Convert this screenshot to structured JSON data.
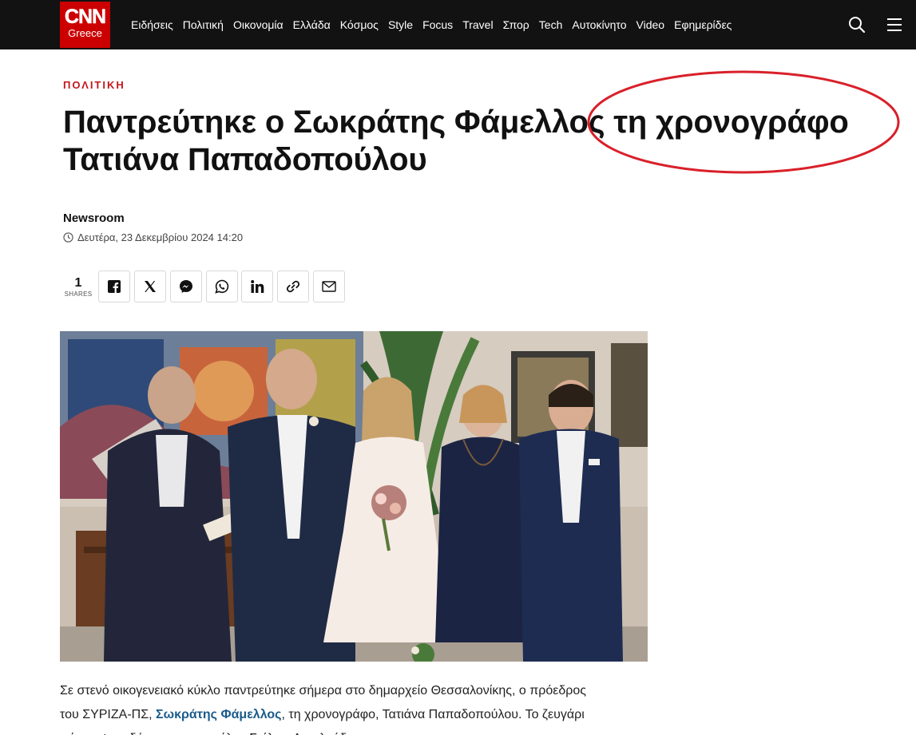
{
  "brand": {
    "logo_main": "CNN",
    "logo_sub": "Greece",
    "color": "#cc0000"
  },
  "nav": {
    "items": [
      "Ειδήσεις",
      "Πολιτική",
      "Οικονομία",
      "Ελλάδα",
      "Κόσμος",
      "Style",
      "Focus",
      "Travel",
      "Σπορ",
      "Tech",
      "Αυτοκίνητο",
      "Video",
      "Εφημερίδες"
    ],
    "search_icon": "search-icon",
    "menu_icon": "hamburger-menu-icon"
  },
  "article": {
    "category": "ΠΟΛΙΤΙΚΗ",
    "title": "Παντρεύτηκε ο Σωκράτης Φάμελλος τη χρονογράφο Τατιάνα Παπαδοπούλου",
    "author": "Newsroom",
    "date": "Δευτέρα, 23 Δεκεμβρίου 2024 14:20",
    "shares": {
      "count": "1",
      "label": "SHARES"
    },
    "share_buttons": [
      "facebook-icon",
      "x-icon",
      "messenger-icon",
      "whatsapp-icon",
      "linkedin-icon",
      "link-icon",
      "email-icon"
    ],
    "body": {
      "line1": "Σε στενό οικογενειακό κύκλο παντρεύτηκε σήμερα στο δημαρχείο Θεσσαλονίκης, ο πρόεδρος",
      "line2_pre": "του ΣΥΡΙΖΑ-ΠΣ, ",
      "line2_link": "Σωκράτης Φάμελλος",
      "line2_post": ", τη χρονογράφο, Τατιάνα Παπαδοπούλου. Το ζευγάρι",
      "line3": "πάντρεψε ο δήμαρχος της πόλης Στέλιος Αγγελούδης."
    }
  },
  "colors": {
    "accent": "#c4161c",
    "link": "#1a5a8a",
    "topbar": "#121212",
    "annotation": "#d9202a"
  }
}
